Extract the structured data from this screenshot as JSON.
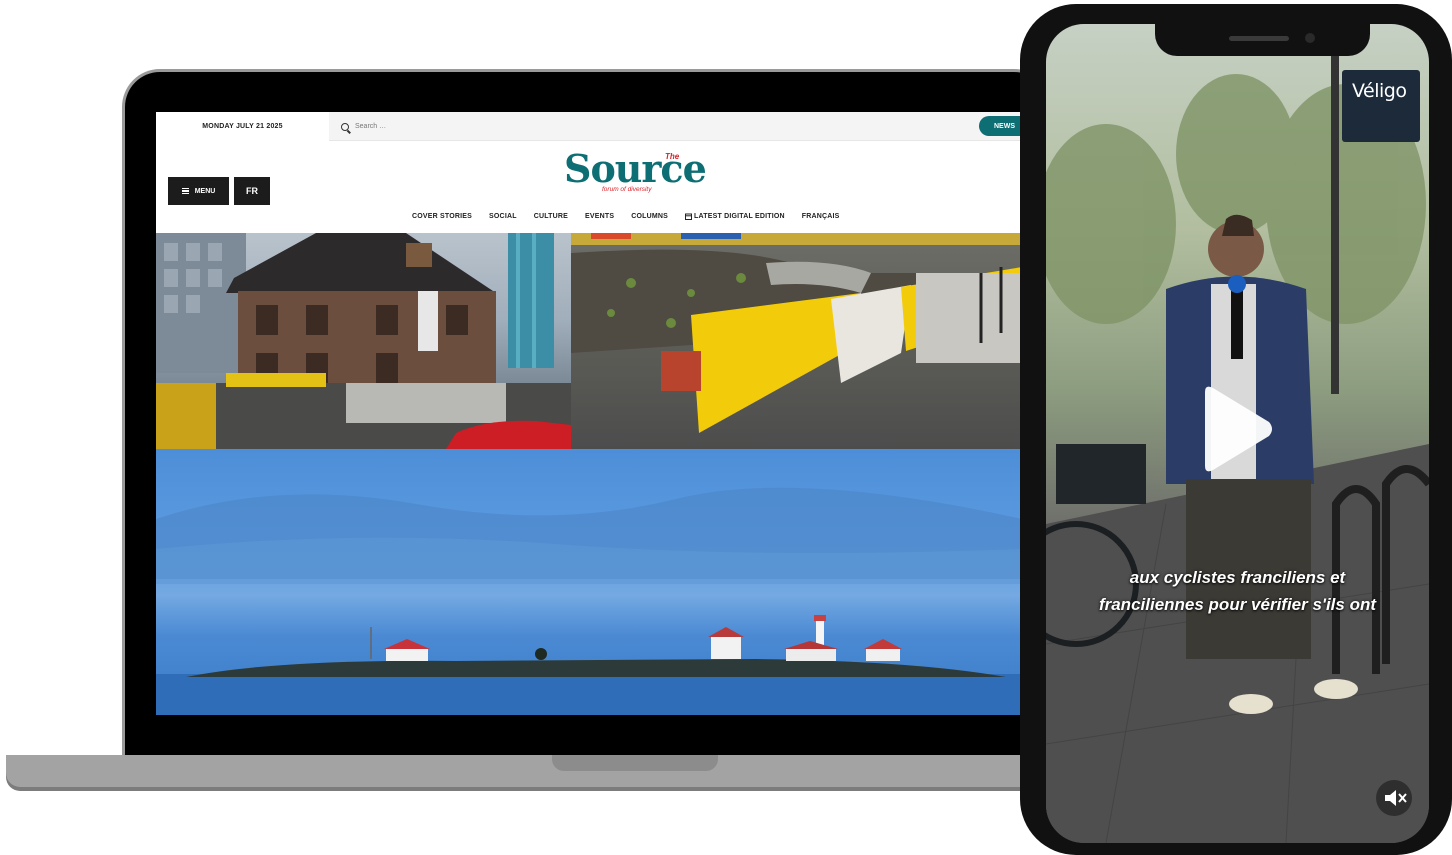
{
  "site": {
    "date": "MONDAY JULY 21 2025",
    "search_placeholder": "Search …",
    "news_button": "NEWS",
    "menu_label": "MENU",
    "lang_button": "FR",
    "logo": {
      "the": "The",
      "name": "Source",
      "tagline": "forum of diversity"
    },
    "nav": [
      "COVER STORIES",
      "SOCIAL",
      "CULTURE",
      "EVENTS",
      "COLUMNS",
      "LATEST DIGITAL EDITION",
      "FRANÇAIS"
    ]
  },
  "phone": {
    "sign_text": "Véligo",
    "caption_line1": "aux cyclistes franciliens et",
    "caption_line2": "franciliennes pour vérifier s'ils ont"
  },
  "colors": {
    "brand_teal": "#0d6e73",
    "brand_red": "#d8232a",
    "button_dark": "#1c1c1c"
  },
  "icons": [
    "search-icon",
    "hamburger-icon",
    "calendar-icon",
    "play-icon",
    "mute-icon"
  ]
}
